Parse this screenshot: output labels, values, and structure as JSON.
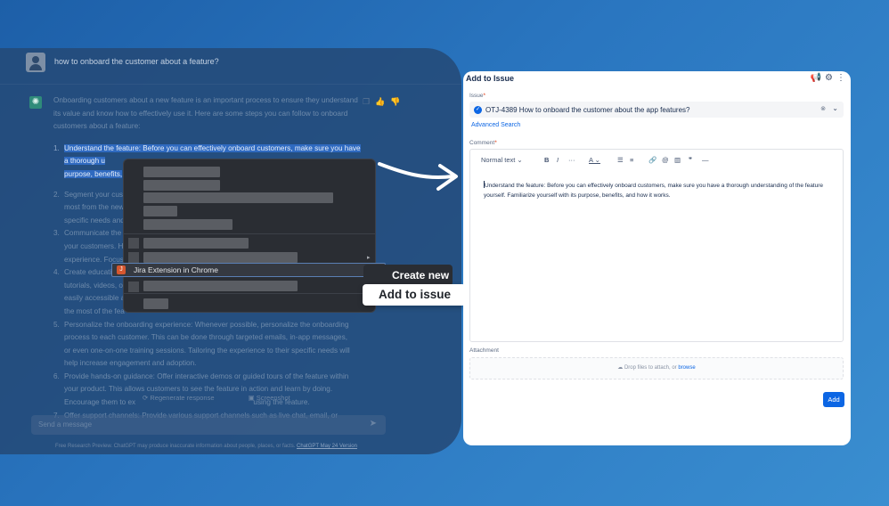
{
  "chat": {
    "user_question": "how to onboard the customer about a feature?",
    "intro": "Onboarding customers about a new feature is an important process to ensure they understand its value and know how to effectively use it. Here are some steps you can follow to onboard customers about a feature:",
    "items": [
      {
        "num": "1.",
        "text": "Understand the feature: Before you can effectively onboard customers, make sure you have a thorough u",
        "text2": "purpose, benefits,"
      },
      {
        "num": "2.",
        "text": "Segment your cust",
        "text2": "most from the new",
        "text3": "specific needs and"
      },
      {
        "num": "3.",
        "text": "Communicate the",
        "text2": "your customers. H",
        "text3": "experience. Focus"
      },
      {
        "num": "4.",
        "text": "Create educati",
        "text2": "tutorials, videos, o",
        "text3": "easily accessible a",
        "text4": "the most of the fea"
      },
      {
        "num": "5.",
        "text": "Personalize the onboarding experience: Whenever possible, personalize the onboarding",
        "text2": "process to each customer. This can be done through targeted emails, in-app messages,",
        "text3": "or even one-on-one training sessions. Tailoring the experience to their specific needs will",
        "text4": "help increase engagement and adoption."
      },
      {
        "num": "6.",
        "text": "Provide hands-on guidance: Offer interactive demos or guided tours of the feature within",
        "text2": "your product. This allows customers to see the feature in action and learn by doing.",
        "text3": "Encourage them to ex",
        "text3b": "using the feature."
      },
      {
        "num": "7.",
        "text": "Offer support channels: Provide various support channels such as live chat, email, or"
      }
    ],
    "regenerate_label": "Regenerate response",
    "screenshot_label": "Screenshot",
    "send_placeholder": "Send a message",
    "footnote": "Free Research Preview. ChatGPT may produce inaccurate information about people, places, or facts.",
    "footnote_link": "ChatGPT May 24 Version"
  },
  "context_menu": {
    "jira_label": "Jira Extension in Chrome",
    "submenu_create": "Create new",
    "submenu_add": "Add to issue"
  },
  "panel": {
    "title": "Add to Issue",
    "issue_label": "Issue",
    "issue_value": "OTJ-4389 How to onboard the customer about the app features?",
    "advanced_search": "Advanced Search",
    "comment_label": "Comment",
    "text_style": "Normal text",
    "comment_text": "Understand the feature: Before you can effectively onboard customers, make sure you have a thorough understanding of the feature yourself. Familiarize yourself with its purpose, benefits, and how it works.",
    "attachment_label": "Attachment",
    "drop_text": "Drop files to attach, or",
    "browse": "browse",
    "add_button": "Add",
    "required_mark": "*"
  },
  "colors": {
    "accent": "#0c66e4",
    "selection": "#2f6ac0",
    "menu_bg": "#2a2d33"
  }
}
